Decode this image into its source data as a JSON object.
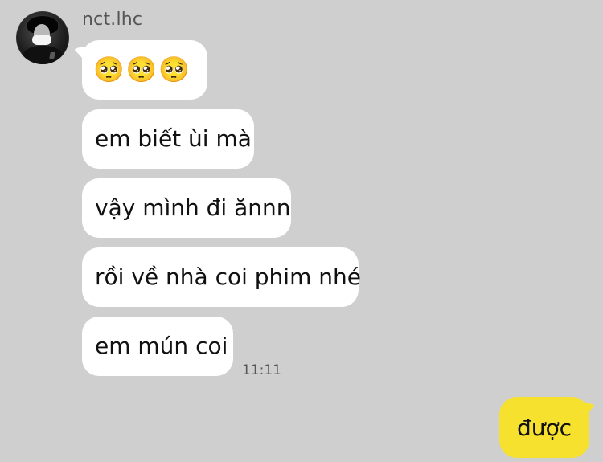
{
  "chat": {
    "username": "nct.lhc",
    "incoming_messages": [
      "🥺🥺🥺",
      "em biết ùi mà",
      "vậy mình đi ănnn",
      "rồi về nhà coi phim nhé",
      "em mún coi"
    ],
    "incoming_time": "11:11",
    "outgoing_message": "được"
  },
  "colors": {
    "background": "#cfcfcf",
    "incoming_bubble": "#ffffff",
    "outgoing_bubble": "#f6e12f"
  }
}
